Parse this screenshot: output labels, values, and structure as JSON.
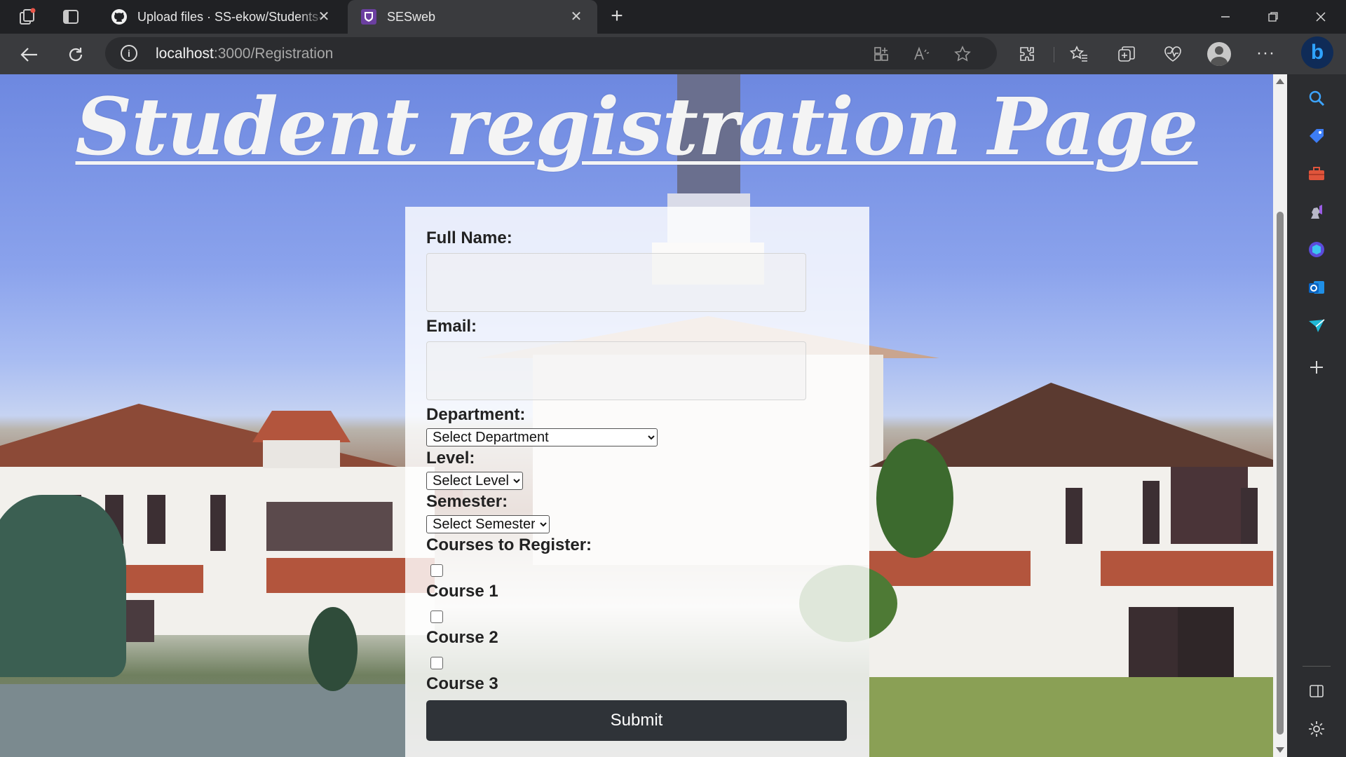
{
  "browser": {
    "tabs": [
      {
        "title": "Upload files · SS-ekow/Students-",
        "favicon": "github-icon"
      },
      {
        "title": "SESweb",
        "favicon": "site-icon"
      }
    ],
    "address": {
      "host": "localhost",
      "path": ":3000/Registration"
    }
  },
  "page": {
    "title": "Student registration Page",
    "form": {
      "full_name_label": "Full Name:",
      "full_name_value": "",
      "email_label": "Email:",
      "email_value": "",
      "department_label": "Department:",
      "department_selected": "Select Department",
      "level_label": "Level:",
      "level_selected": "Select Level",
      "semester_label": "Semester:",
      "semester_selected": "Select Semester",
      "courses_label": "Courses to Register:",
      "courses": [
        {
          "label": "Course 1",
          "checked": false
        },
        {
          "label": "Course 2",
          "checked": false
        },
        {
          "label": "Course 3",
          "checked": false
        }
      ],
      "submit_label": "Submit"
    }
  }
}
